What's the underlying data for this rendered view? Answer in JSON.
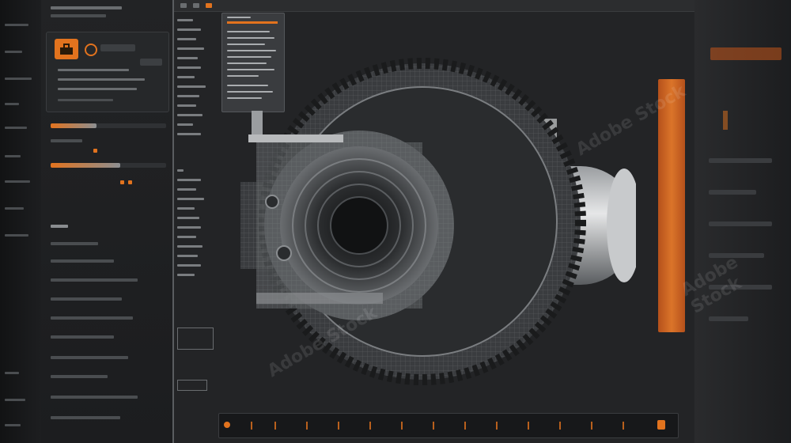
{
  "stock_id": "1114779168",
  "watermark": "Adobe Stock",
  "accent_color": "#e2731e",
  "icons": {
    "tool_button": "toolbox-icon",
    "tool_dial": "dial-icon",
    "play": "play-icon",
    "end_marker": "end-marker-icon"
  },
  "viewport": {
    "subject": "turbine-engine-wireframe-model"
  }
}
